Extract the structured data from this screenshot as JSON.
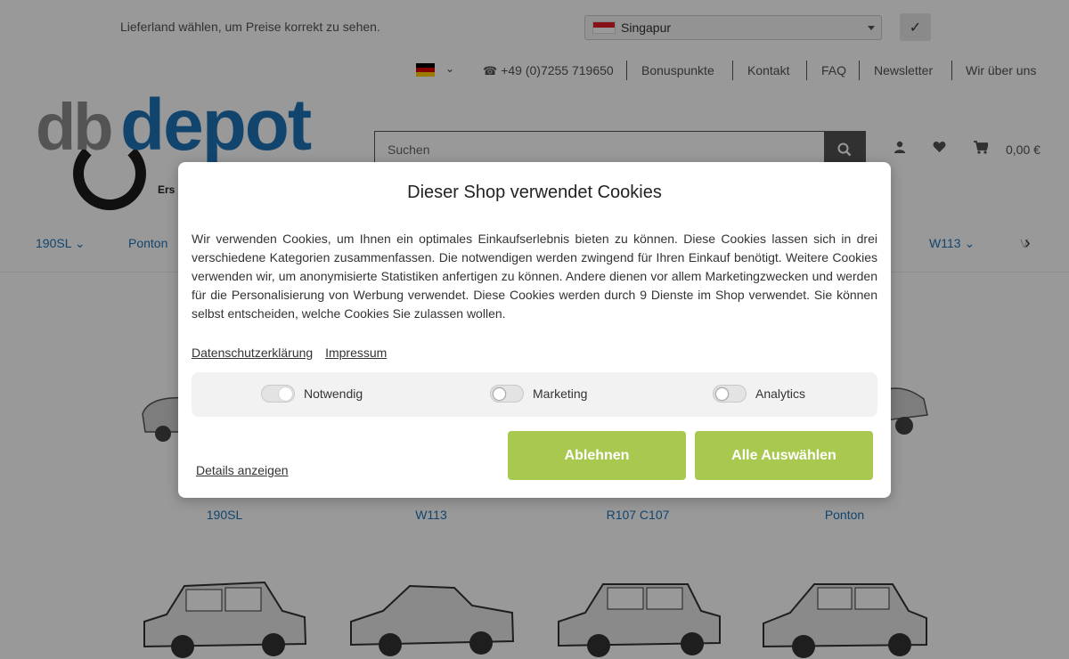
{
  "colors": {
    "accent_blue": "#1f74b8",
    "accept_green": "#a8c84f",
    "dark": "#525252"
  },
  "topbar": {
    "hint": "Lieferland wählen, um Preise korrekt zu sehen.",
    "country_value": "Singapur",
    "confirm_label": "✓"
  },
  "metanav": {
    "phone": "+49 (0)7255 719650",
    "links": [
      "Bonuspunkte",
      "Kontakt",
      "FAQ",
      "Newsletter",
      "Wir über uns"
    ]
  },
  "logo": {
    "text_left": "db",
    "text_right": "depot",
    "tagline": "Ers"
  },
  "search": {
    "placeholder": "Suchen"
  },
  "header": {
    "cart_total": "0,00 €"
  },
  "mainnav": {
    "items": [
      "190SL",
      "Ponton",
      "W113",
      "V"
    ]
  },
  "tiles": {
    "row1": [
      "190SL",
      "W113",
      "R107 C107",
      "Ponton"
    ]
  },
  "modal": {
    "title": "Dieser Shop verwendet Cookies",
    "body": "Wir verwenden Cookies, um Ihnen ein optimales Einkaufserlebnis bieten zu können. Diese Cookies lassen sich in drei verschiedene Kategorien zusammenfassen. Die notwendigen werden zwingend für Ihren Einkauf benötigt. Weitere Cookies verwenden wir, um anonymisierte Statistiken anfertigen zu können. Andere dienen vor allem Marketingzwecken und werden für die Personalisierung von Werbung verwendet. Diese Cookies werden durch 9 Dienste im Shop verwendet. Sie können selbst entscheiden, welche Cookies Sie zulassen wollen.",
    "link_privacy": "Datenschutzerklärung",
    "link_imprint": "Impressum",
    "toggles": [
      {
        "label": "Notwendig",
        "on": true
      },
      {
        "label": "Marketing",
        "on": false
      },
      {
        "label": "Analytics",
        "on": false
      }
    ],
    "details": "Details anzeigen",
    "btn_decline": "Ablehnen",
    "btn_accept_all": "Alle Auswählen"
  }
}
